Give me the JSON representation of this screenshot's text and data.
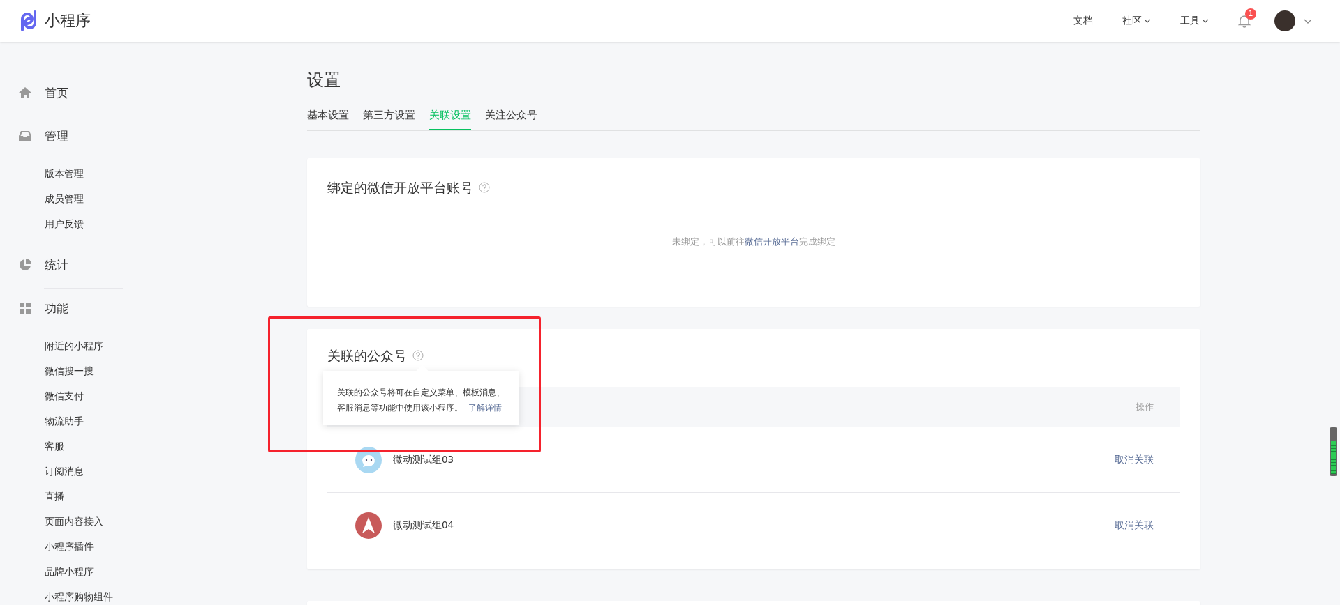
{
  "header": {
    "logo": "小程序",
    "nav": [
      {
        "label": "文档",
        "dropdown": false
      },
      {
        "label": "社区",
        "dropdown": true
      },
      {
        "label": "工具",
        "dropdown": true
      }
    ],
    "notification_badge": "1"
  },
  "sidebar": {
    "sections": [
      {
        "label": "首页",
        "kind": "home"
      },
      {
        "label": "管理",
        "kind": "inbox",
        "children": [
          "版本管理",
          "成员管理",
          "用户反馈"
        ]
      },
      {
        "label": "统计",
        "kind": "pie"
      },
      {
        "label": "功能",
        "kind": "grid",
        "children": [
          "附近的小程序",
          "微信搜一搜",
          "微信支付",
          "物流助手",
          "客服",
          "订阅消息",
          "直播",
          "页面内容接入",
          "小程序插件",
          "品牌小程序",
          "小程序购物组件"
        ]
      }
    ]
  },
  "page": {
    "title": "设置",
    "tabs": [
      {
        "label": "基本设置",
        "selected": false
      },
      {
        "label": "第三方设置",
        "selected": false
      },
      {
        "label": "关联设置",
        "selected": true
      },
      {
        "label": "关注公众号",
        "selected": false
      }
    ]
  },
  "open_platform_card": {
    "title": "绑定的微信开放平台账号",
    "message_before": "未绑定，可以前往",
    "message_link": "微信开放平台",
    "message_after": "完成绑定"
  },
  "linked_accounts_card": {
    "title": "关联的公众号",
    "tooltip": {
      "text": "关联的公众号将可在自定义菜单、模板消息、客服消息等功能中使用该小程序。",
      "link": "了解详情"
    },
    "table": {
      "columns": [
        "操作"
      ],
      "rows": [
        {
          "kind": "bubble",
          "name": "微动测试组03",
          "action": "取消关联"
        },
        {
          "kind": "arrow",
          "name": "微动测试组04",
          "action": "取消关联"
        }
      ]
    }
  }
}
